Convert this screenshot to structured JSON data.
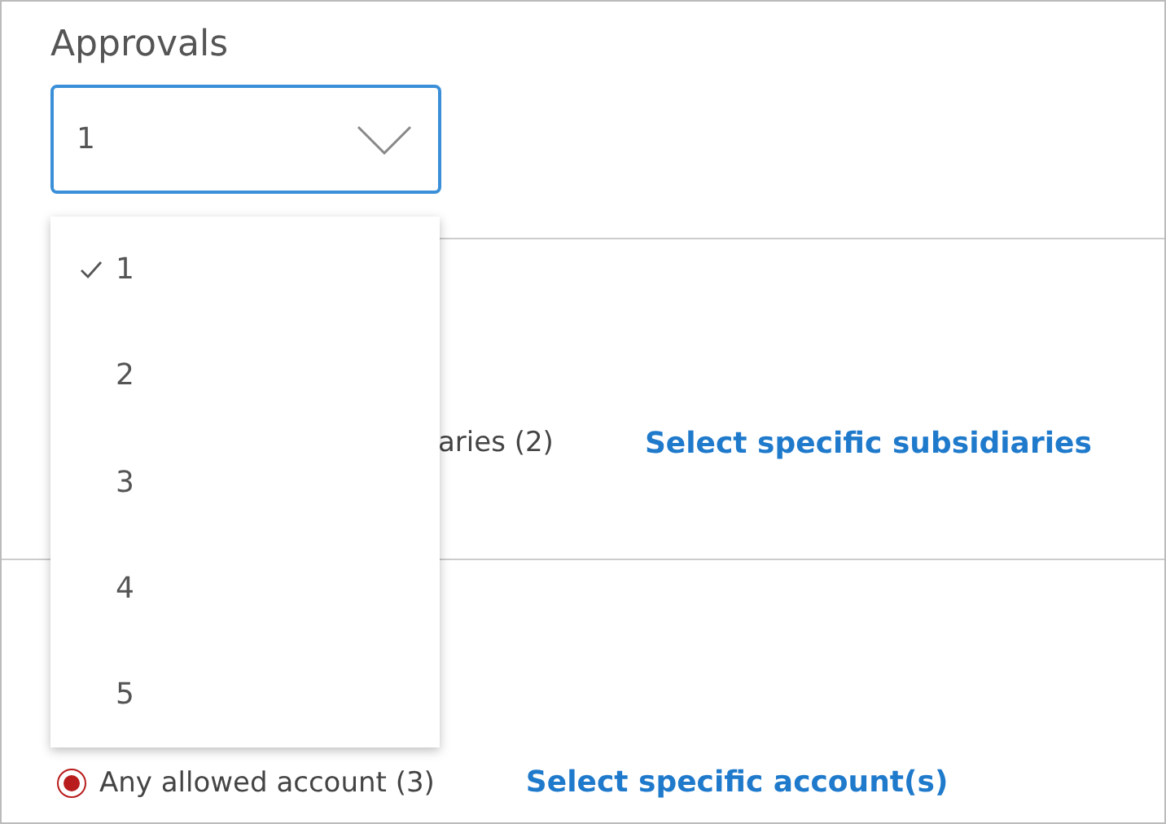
{
  "title": "Approvals",
  "select": {
    "value": "1",
    "expanded": true,
    "options": [
      {
        "label": "1",
        "selected": true
      },
      {
        "label": "2",
        "selected": false
      },
      {
        "label": "3",
        "selected": false
      },
      {
        "label": "4",
        "selected": false
      },
      {
        "label": "5",
        "selected": false
      }
    ]
  },
  "subsidiaries": {
    "option_text": "aries (2)",
    "link": "Select specific subsidiaries"
  },
  "accounts": {
    "option_text": "Any allowed account (3)",
    "checked": true,
    "link": "Select specific account(s)"
  }
}
